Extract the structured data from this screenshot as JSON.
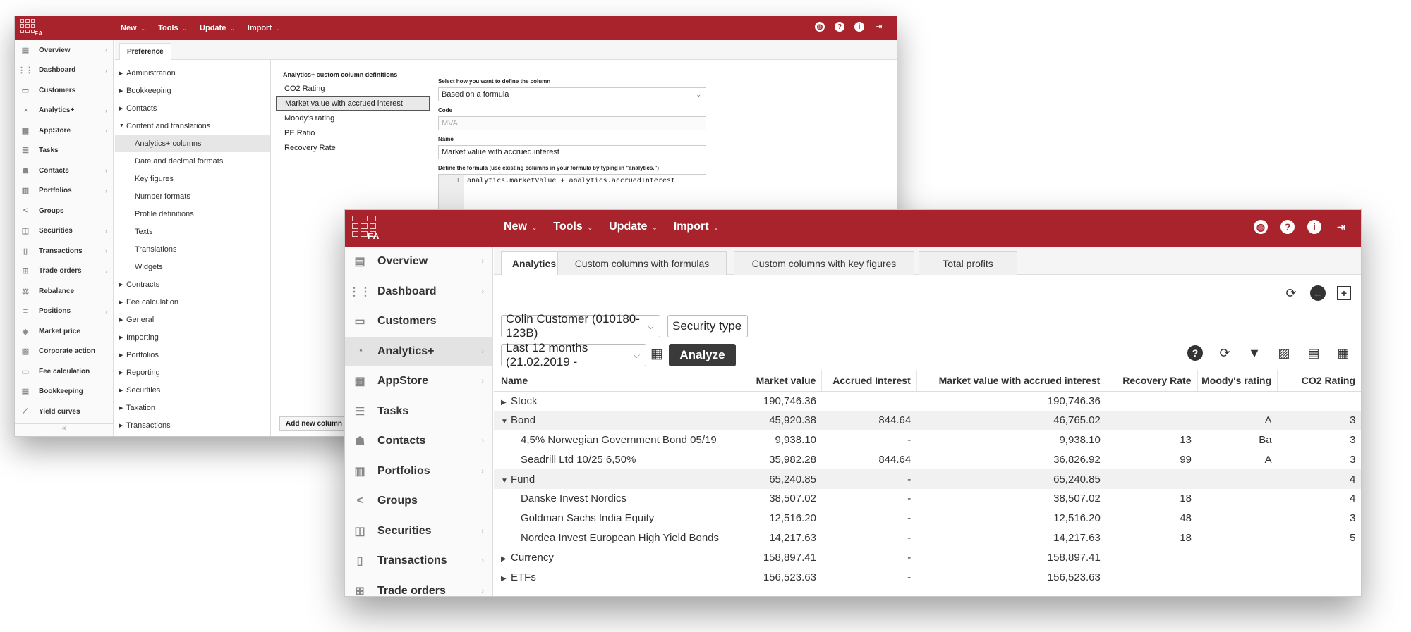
{
  "back": {
    "logo_text": "FA",
    "menu": [
      "New",
      "Tools",
      "Update",
      "Import"
    ],
    "sidebar": [
      {
        "label": "Overview",
        "icon": "overview-icon",
        "glyph": "▤",
        "chev": true
      },
      {
        "label": "Dashboard",
        "icon": "dashboard-icon",
        "glyph": "⋮⋮",
        "chev": true
      },
      {
        "label": "Customers",
        "icon": "customers-icon",
        "glyph": "▭",
        "chev": false
      },
      {
        "label": "Analytics+",
        "icon": "analytics-icon",
        "glyph": "◔",
        "chev": true
      },
      {
        "label": "AppStore",
        "icon": "appstore-icon",
        "glyph": "▦",
        "chev": true
      },
      {
        "label": "Tasks",
        "icon": "tasks-icon",
        "glyph": "☰",
        "chev": false
      },
      {
        "label": "Contacts",
        "icon": "contacts-icon",
        "glyph": "☗",
        "chev": true
      },
      {
        "label": "Portfolios",
        "icon": "portfolios-icon",
        "glyph": "▥",
        "chev": true
      },
      {
        "label": "Groups",
        "icon": "groups-icon",
        "glyph": "<",
        "chev": false
      },
      {
        "label": "Securities",
        "icon": "securities-icon",
        "glyph": "◫",
        "chev": true
      },
      {
        "label": "Transactions",
        "icon": "transactions-icon",
        "glyph": "▯",
        "chev": true
      },
      {
        "label": "Trade orders",
        "icon": "trade-orders-icon",
        "glyph": "⊞",
        "chev": true
      },
      {
        "label": "Rebalance",
        "icon": "rebalance-icon",
        "glyph": "⚖",
        "chev": false
      },
      {
        "label": "Positions",
        "icon": "positions-icon",
        "glyph": "≡",
        "chev": true
      },
      {
        "label": "Market price",
        "icon": "market-price-icon",
        "glyph": "◈",
        "chev": false
      },
      {
        "label": "Corporate action",
        "icon": "corporate-action-icon",
        "glyph": "▧",
        "chev": false
      },
      {
        "label": "Fee calculation",
        "icon": "fee-calculation-icon",
        "glyph": "▭",
        "chev": false
      },
      {
        "label": "Bookkeeping",
        "icon": "bookkeeping-icon",
        "glyph": "▤",
        "chev": false
      },
      {
        "label": "Yield curves",
        "icon": "yield-curves-icon",
        "glyph": "⟋",
        "chev": false
      }
    ],
    "collapse_label": "«",
    "tab": "Preference",
    "tree": [
      {
        "label": "Administration",
        "type": "collapsed"
      },
      {
        "label": "Bookkeeping",
        "type": "collapsed"
      },
      {
        "label": "Contacts",
        "type": "collapsed"
      },
      {
        "label": "Content and translations",
        "type": "expanded"
      },
      {
        "label": "Analytics+ columns",
        "type": "child-selected"
      },
      {
        "label": "Date and decimal formats",
        "type": "child"
      },
      {
        "label": "Key figures",
        "type": "child"
      },
      {
        "label": "Number formats",
        "type": "child"
      },
      {
        "label": "Profile definitions",
        "type": "child"
      },
      {
        "label": "Texts",
        "type": "child"
      },
      {
        "label": "Translations",
        "type": "child"
      },
      {
        "label": "Widgets",
        "type": "child"
      },
      {
        "label": "Contracts",
        "type": "collapsed"
      },
      {
        "label": "Fee calculation",
        "type": "collapsed"
      },
      {
        "label": "General",
        "type": "collapsed"
      },
      {
        "label": "Importing",
        "type": "collapsed"
      },
      {
        "label": "Portfolios",
        "type": "collapsed"
      },
      {
        "label": "Reporting",
        "type": "collapsed"
      },
      {
        "label": "Securities",
        "type": "collapsed"
      },
      {
        "label": "Taxation",
        "type": "collapsed"
      },
      {
        "label": "Transactions",
        "type": "collapsed"
      }
    ],
    "columns_heading": "Analytics+ custom column definitions",
    "columns": [
      "CO2 Rating",
      "Market value with accrued interest",
      "Moody's rating",
      "PE Ratio",
      "Recovery Rate"
    ],
    "selected_column": 1,
    "add_button": "Add new column",
    "form": {
      "define_label": "Select how you want to define the column",
      "define_value": "Based on a formula",
      "code_label": "Code",
      "code_value": "MVA",
      "name_label": "Name",
      "name_value": "Market value with accrued interest",
      "formula_label": "Define the formula (use existing columns in your formula by typing in \"analytics.\")",
      "formula_line": "1",
      "formula_value": "analytics.marketValue + analytics.accruedInterest"
    }
  },
  "front": {
    "logo_text": "FA",
    "menu": [
      "New",
      "Tools",
      "Update",
      "Import"
    ],
    "sidebar": [
      {
        "label": "Overview",
        "icon": "overview-icon",
        "glyph": "▤",
        "chev": true
      },
      {
        "label": "Dashboard",
        "icon": "dashboard-icon",
        "glyph": "⋮⋮",
        "chev": true
      },
      {
        "label": "Customers",
        "icon": "customers-icon",
        "glyph": "▭",
        "chev": false
      },
      {
        "label": "Analytics+",
        "icon": "analytics-icon",
        "glyph": "◔",
        "chev": true
      },
      {
        "label": "AppStore",
        "icon": "appstore-icon",
        "glyph": "▦",
        "chev": true
      },
      {
        "label": "Tasks",
        "icon": "tasks-icon",
        "glyph": "☰",
        "chev": false
      },
      {
        "label": "Contacts",
        "icon": "contacts-icon",
        "glyph": "☗",
        "chev": true
      },
      {
        "label": "Portfolios",
        "icon": "portfolios-icon",
        "glyph": "▥",
        "chev": true
      },
      {
        "label": "Groups",
        "icon": "groups-icon",
        "glyph": "<",
        "chev": false
      },
      {
        "label": "Securities",
        "icon": "securities-icon",
        "glyph": "◫",
        "chev": true
      },
      {
        "label": "Transactions",
        "icon": "transactions-icon",
        "glyph": "▯",
        "chev": true
      },
      {
        "label": "Trade orders",
        "icon": "trade-orders-icon",
        "glyph": "⊞",
        "chev": true
      }
    ],
    "selected_sidebar": 3,
    "tabs": [
      "Analytics",
      "Custom columns with formulas",
      "Custom columns with key figures",
      "Total profits"
    ],
    "active_tab": 0,
    "customer_select": "Colin Customer (010180-123B)",
    "grouping_select": "Security type",
    "period_select": "Last 12 months (21.02.2019 -",
    "analyze_label": "Analyze",
    "table": {
      "headers": [
        "Name",
        "Market value",
        "Accrued Interest",
        "Market value with accrued interest",
        "Recovery Rate",
        "Moody's rating",
        "CO2 Rating"
      ],
      "rows": [
        {
          "kind": "group-collapsed",
          "cells": [
            "Stock",
            "190,746.36",
            "",
            "190,746.36",
            "",
            "",
            ""
          ]
        },
        {
          "kind": "group-expanded",
          "cells": [
            "Bond",
            "45,920.38",
            "844.64",
            "46,765.02",
            "",
            "A",
            "3"
          ]
        },
        {
          "kind": "child",
          "cells": [
            "4,5% Norwegian Government Bond 05/19",
            "9,938.10",
            "-",
            "9,938.10",
            "13",
            "Ba",
            "3"
          ]
        },
        {
          "kind": "child",
          "cells": [
            "Seadrill Ltd 10/25 6,50%",
            "35,982.28",
            "844.64",
            "36,826.92",
            "99",
            "A",
            "3"
          ]
        },
        {
          "kind": "group-expanded",
          "cells": [
            "Fund",
            "65,240.85",
            "-",
            "65,240.85",
            "",
            "",
            "4"
          ]
        },
        {
          "kind": "child",
          "cells": [
            "Danske Invest Nordics",
            "38,507.02",
            "-",
            "38,507.02",
            "18",
            "",
            "4"
          ]
        },
        {
          "kind": "child",
          "cells": [
            "Goldman Sachs India Equity",
            "12,516.20",
            "-",
            "12,516.20",
            "48",
            "",
            "3"
          ]
        },
        {
          "kind": "child",
          "cells": [
            "Nordea Invest European High Yield Bonds",
            "14,217.63",
            "-",
            "14,217.63",
            "18",
            "",
            "5"
          ]
        },
        {
          "kind": "group-collapsed",
          "cells": [
            "Currency",
            "158,897.41",
            "-",
            "158,897.41",
            "",
            "",
            ""
          ]
        },
        {
          "kind": "group-collapsed",
          "cells": [
            "ETFs",
            "156,523.63",
            "-",
            "156,523.63",
            "",
            "",
            ""
          ]
        }
      ]
    }
  },
  "colors": {
    "brand": "#a8232b",
    "button_dark": "#3a3a3a"
  }
}
